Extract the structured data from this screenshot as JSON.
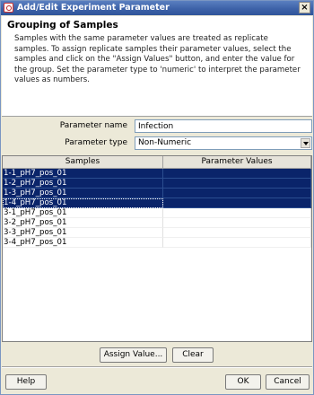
{
  "window": {
    "title": "Add/Edit Experiment Parameter",
    "close_label": "×"
  },
  "header": {
    "heading": "Grouping of Samples",
    "description": "Samples with the same parameter values are treated as replicate samples. To assign replicate samples their parameter values, select the samples and click on the \"Assign Values\" button, and enter the value for the group. Set the parameter type to 'numeric' to interpret the parameter values as numbers."
  },
  "form": {
    "parameter_name_label": "Parameter name",
    "parameter_name_value": "Infection",
    "parameter_type_label": "Parameter type",
    "parameter_type_value": "Non-Numeric"
  },
  "table": {
    "columns": [
      "Samples",
      "Parameter Values"
    ],
    "rows": [
      {
        "sample": "1-1_pH7_pos_01",
        "value": "",
        "selected": true
      },
      {
        "sample": "1-2_pH7_pos_01",
        "value": "",
        "selected": true
      },
      {
        "sample": "1-3_pH7_pos_01",
        "value": "",
        "selected": true
      },
      {
        "sample": "1-4_pH7_pos_01",
        "value": "",
        "selected": true
      },
      {
        "sample": "3-1_pH7_pos_01",
        "value": "",
        "selected": false
      },
      {
        "sample": "3-2_pH7_pos_01",
        "value": "",
        "selected": false
      },
      {
        "sample": "3-3_pH7_pos_01",
        "value": "",
        "selected": false
      },
      {
        "sample": "3-4_pH7_pos_01",
        "value": "",
        "selected": false
      }
    ]
  },
  "actions": {
    "assign_label": "Assign Value...",
    "clear_label": "Clear"
  },
  "footer": {
    "help_label": "Help",
    "ok_label": "OK",
    "cancel_label": "Cancel"
  }
}
